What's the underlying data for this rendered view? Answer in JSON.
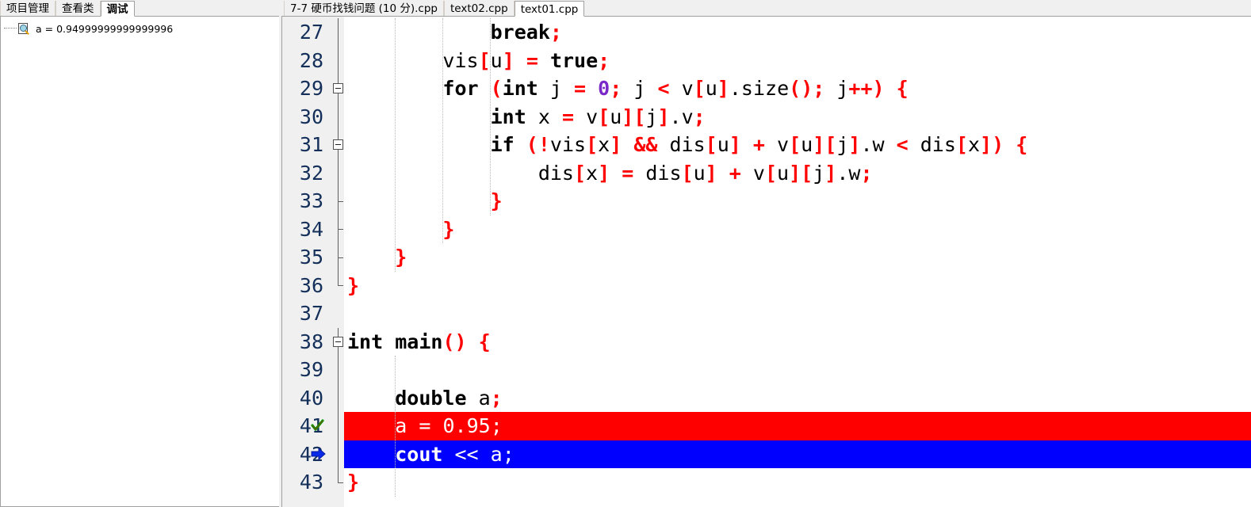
{
  "left_panel": {
    "tabs": [
      {
        "label": "项目管理",
        "active": false
      },
      {
        "label": "查看类",
        "active": false
      },
      {
        "label": "调试",
        "active": true
      }
    ],
    "watch": {
      "icon": "watch-magnifier-icon",
      "text": "a = 0.94999999999999996",
      "expression": "a",
      "value": "0.94999999999999996"
    }
  },
  "editor": {
    "tabs": [
      {
        "label": "7-7 硬币找钱问题 (10 分).cpp",
        "active": false
      },
      {
        "label": "text02.cpp",
        "active": false
      },
      {
        "label": "text01.cpp",
        "active": true
      }
    ],
    "first_line_number": 27,
    "lines": [
      {
        "n": 27,
        "text": "            break;",
        "fold": "none",
        "marker": "none",
        "highlight": "none"
      },
      {
        "n": 28,
        "text": "        vis[u] = true;",
        "fold": "none",
        "marker": "none",
        "highlight": "none"
      },
      {
        "n": 29,
        "text": "        for (int j = 0; j < v[u].size(); j++) {",
        "fold": "open",
        "marker": "none",
        "highlight": "none"
      },
      {
        "n": 30,
        "text": "            int x = v[u][j].v;",
        "fold": "none",
        "marker": "none",
        "highlight": "none"
      },
      {
        "n": 31,
        "text": "            if (!vis[x] && dis[u] + v[u][j].w < dis[x]) {",
        "fold": "open",
        "marker": "none",
        "highlight": "none"
      },
      {
        "n": 32,
        "text": "                dis[x] = dis[u] + v[u][j].w;",
        "fold": "none",
        "marker": "none",
        "highlight": "none"
      },
      {
        "n": 33,
        "text": "            }",
        "fold": "tick",
        "marker": "none",
        "highlight": "none"
      },
      {
        "n": 34,
        "text": "        }",
        "fold": "tick",
        "marker": "none",
        "highlight": "none"
      },
      {
        "n": 35,
        "text": "    }",
        "fold": "tick",
        "marker": "none",
        "highlight": "none"
      },
      {
        "n": 36,
        "text": "}",
        "fold": "end",
        "marker": "none",
        "highlight": "none"
      },
      {
        "n": 37,
        "text": "",
        "fold": "none",
        "marker": "none",
        "highlight": "none"
      },
      {
        "n": 38,
        "text": "int main() {",
        "fold": "open",
        "marker": "none",
        "highlight": "none"
      },
      {
        "n": 39,
        "text": "",
        "fold": "none",
        "marker": "none",
        "highlight": "none"
      },
      {
        "n": 40,
        "text": "    double a;",
        "fold": "none",
        "marker": "none",
        "highlight": "none"
      },
      {
        "n": 41,
        "text": "    a = 0.95;",
        "fold": "none",
        "marker": "breakpoint-check",
        "highlight": "red"
      },
      {
        "n": 42,
        "text": "    cout << a;",
        "fold": "none",
        "marker": "current-arrow",
        "highlight": "blue"
      },
      {
        "n": 43,
        "text": "}",
        "fold": "end",
        "marker": "none",
        "highlight": "none"
      }
    ]
  },
  "colors": {
    "breakpoint_line": "#ff0000",
    "current_line": "#0000ff",
    "keyword": "#000000",
    "operator": "#ff0000",
    "number": "#7b28c8",
    "line_number": "#14305a",
    "gutter_bg": "#f0f0f0",
    "editor_bg": "#ffffff",
    "chrome_bg": "#f0f0f0"
  }
}
